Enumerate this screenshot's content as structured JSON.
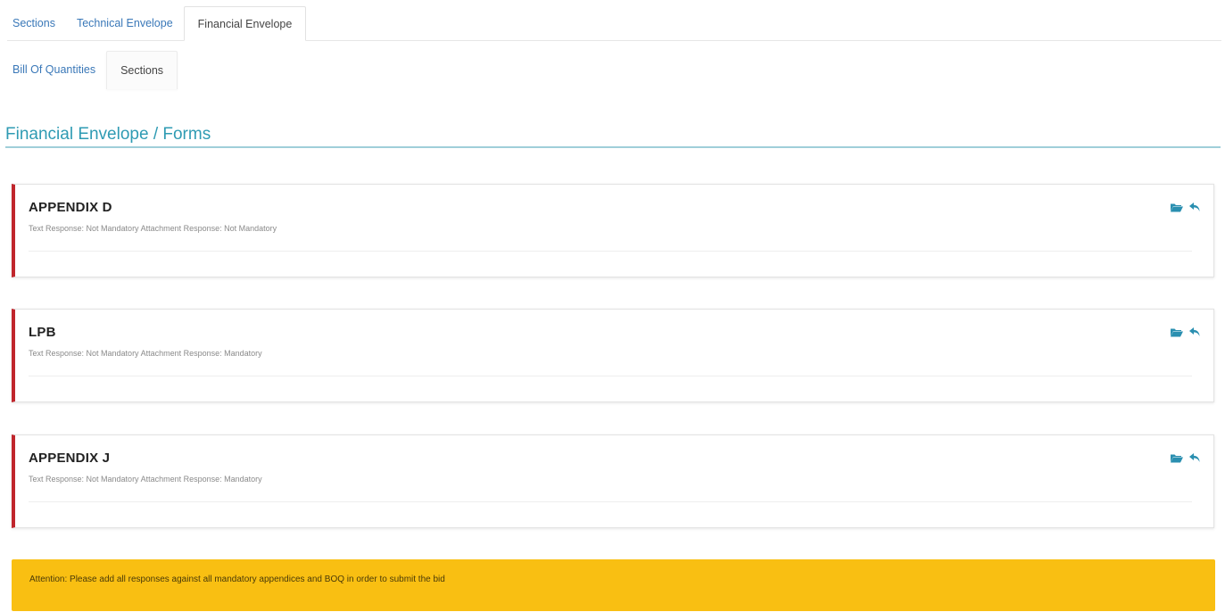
{
  "tabs_top": [
    {
      "label": "Sections",
      "active": false
    },
    {
      "label": "Technical Envelope",
      "active": false
    },
    {
      "label": "Financial Envelope",
      "active": true
    }
  ],
  "tabs_sub": [
    {
      "label": "Bill Of Quantities",
      "active": false
    },
    {
      "label": "Sections",
      "active": true
    }
  ],
  "section_title": "Financial Envelope / Forms",
  "forms": [
    {
      "title": "APPENDIX D",
      "meta": "Text Response: Not Mandatory  Attachment Response: Not Mandatory"
    },
    {
      "title": "LPB",
      "meta": "Text Response: Not Mandatory  Attachment Response: Mandatory"
    },
    {
      "title": "APPENDIX J",
      "meta": "Text Response: Not Mandatory  Attachment Response: Mandatory"
    }
  ],
  "card_icons": [
    "folder-open-icon",
    "reply-icon"
  ],
  "alert": {
    "text": "Attention: Please add all responses against all mandatory appendices and BOQ in order to submit the bid"
  },
  "colors": {
    "accent": "#2f9bb3",
    "link": "#3a78b8",
    "card_border_left": "#c0262c",
    "alert_bg": "#f9bf12",
    "icon": "#2a8fb0"
  }
}
